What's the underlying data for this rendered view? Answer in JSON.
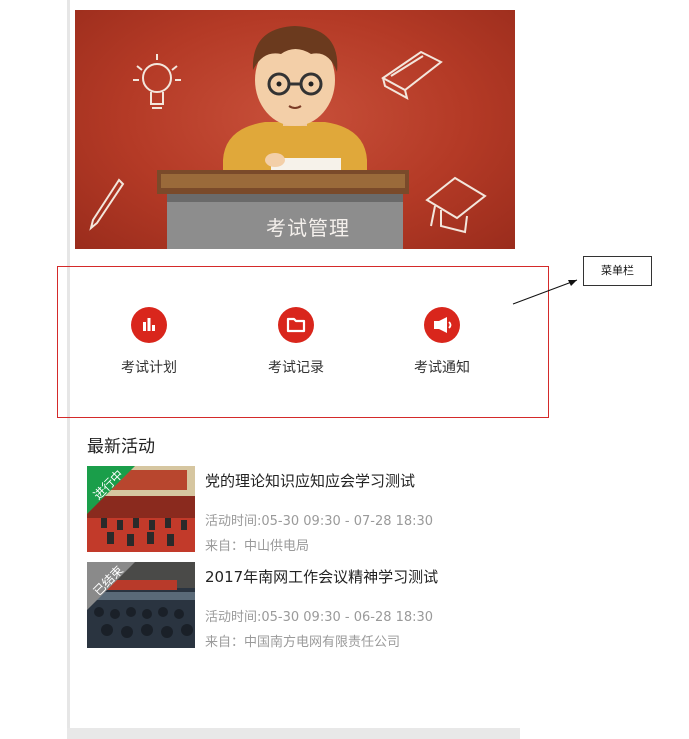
{
  "banner": {
    "title": "考试管理"
  },
  "menu": {
    "items": [
      {
        "label": "考试计划",
        "icon": "bar-chart-icon"
      },
      {
        "label": "考试记录",
        "icon": "folder-icon"
      },
      {
        "label": "考试通知",
        "icon": "megaphone-icon"
      }
    ]
  },
  "annotation": {
    "callout_label": "菜单栏"
  },
  "activities": {
    "section_title": "最新活动",
    "items": [
      {
        "title": "党的理论知识应知应会学习测试",
        "time": "活动时间:05-30 09:30 - 07-28 18:30",
        "source": "来自：中山供电局",
        "status": "进行中",
        "status_color": "#1a9e4a"
      },
      {
        "title": "2017年南网工作会议精神学习测试",
        "time": "活动时间:05-30 09:30 - 06-28 18:30",
        "source": "来自：中国南方电网有限责任公司",
        "status": "已结束",
        "status_color": "#8a8a8a"
      }
    ]
  },
  "colors": {
    "accent": "#d9261c",
    "menu_border": "#d42a2a",
    "banner_red": "#b43a26"
  }
}
